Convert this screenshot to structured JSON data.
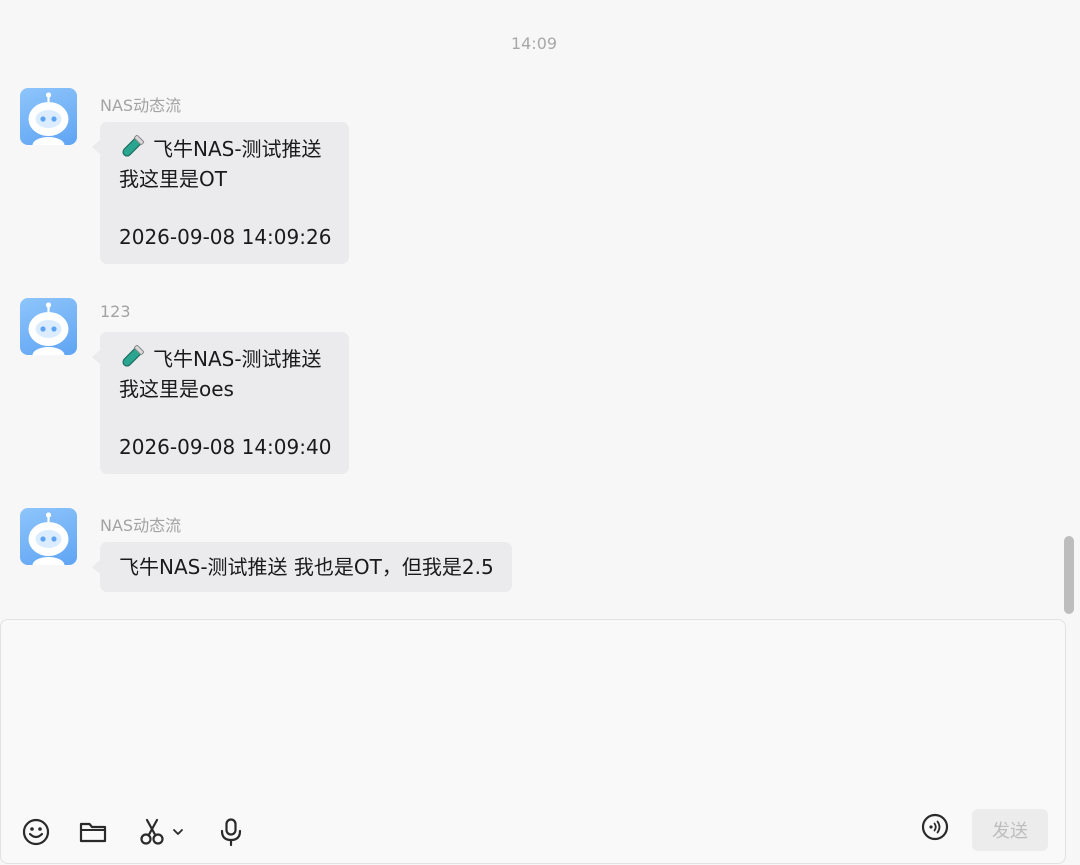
{
  "chat": {
    "timestamp": "14:09",
    "messages": [
      {
        "sender": "NAS动态流",
        "title": "飞牛NAS-测试推送",
        "line2": "我这里是OT",
        "time": "2026-09-08 14:09:26",
        "has_test_tube_icon": true
      },
      {
        "sender": "123",
        "title": "飞牛NAS-测试推送",
        "line2": "我这里是oes",
        "time": "2026-09-08 14:09:40",
        "has_test_tube_icon": true
      },
      {
        "sender": "NAS动态流",
        "text": "飞牛NAS-测试推送 我也是OT，但我是2.5"
      }
    ]
  },
  "composer": {
    "send_label": "发送",
    "tools": [
      "emoji-icon",
      "folder-icon",
      "scissors-icon",
      "chevron-down-icon",
      "microphone-icon"
    ],
    "right_tool": "voice-wave-icon"
  },
  "colors": {
    "bubble": "#ebebee",
    "avatar": "#6aaef5",
    "test_tube": "#2aa58f"
  }
}
